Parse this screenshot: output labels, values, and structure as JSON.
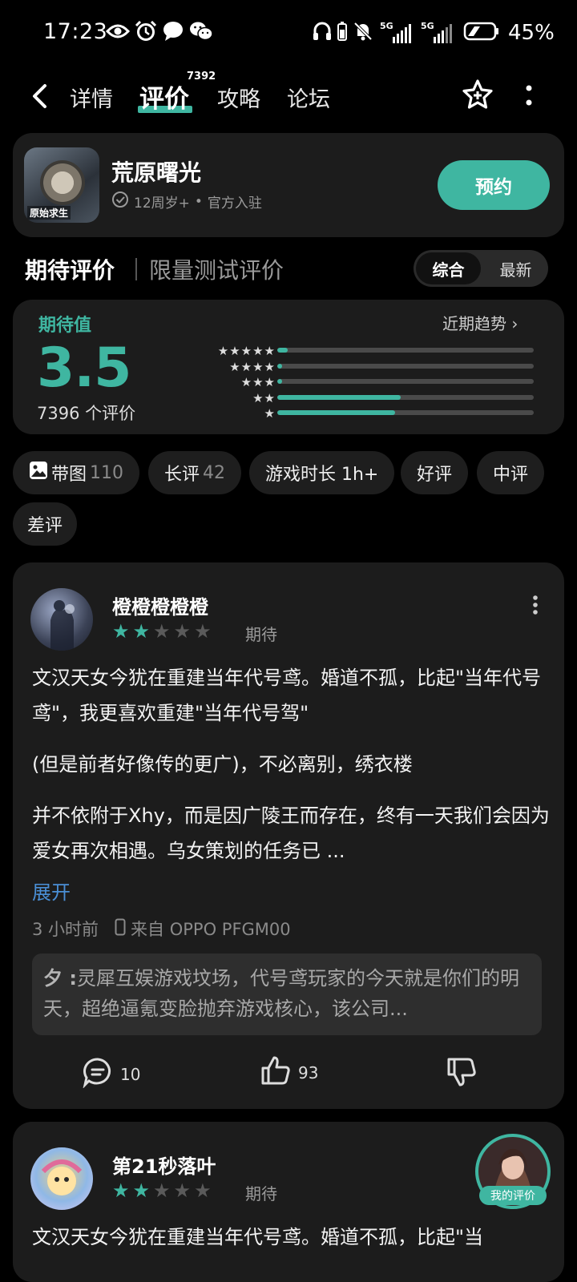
{
  "status_bar": {
    "time": "17:23",
    "battery": "45%",
    "left_icons": [
      "eye-icon",
      "alarm-icon",
      "chat-bubble-icon",
      "wechat-icon"
    ],
    "right_icons": [
      "headphones-icon",
      "battery-small-icon",
      "mute-bell-icon",
      "signal-5g-icon",
      "signal-5g-icon",
      "battery-icon"
    ],
    "net1": "5G",
    "net2": "5G"
  },
  "nav": {
    "tabs": [
      "详情",
      "评价",
      "攻略",
      "论坛"
    ],
    "active_tab": "评价",
    "badge": "7392"
  },
  "game": {
    "title": "荒原曙光",
    "icon_caption": "原始求生",
    "age": "12周岁+",
    "official": "官方入驻",
    "reserve_label": "预约"
  },
  "rating_header": {
    "main": "期待评价",
    "sub": "限量测试评价",
    "sort_options": [
      "综合",
      "最新"
    ],
    "sort_selected": "综合"
  },
  "score": {
    "label": "期待值",
    "value": "3.5",
    "count_text": "7396 个评价",
    "trend_label": "近期趋势",
    "distribution": [
      {
        "stars": "★★★★★",
        "fraction": 0.04
      },
      {
        "stars": "★★★★",
        "fraction": 0.02
      },
      {
        "stars": "★★★",
        "fraction": 0.02
      },
      {
        "stars": "★★",
        "fraction": 0.48
      },
      {
        "stars": "★",
        "fraction": 0.46
      }
    ],
    "accent": "#3fb6a1"
  },
  "filters": [
    {
      "label": "带图",
      "count": "110",
      "icon": "image-icon"
    },
    {
      "label": "长评",
      "count": "42"
    },
    {
      "label": "游戏时长 1h+",
      "count": ""
    },
    {
      "label": "好评",
      "count": ""
    },
    {
      "label": "中评",
      "count": ""
    },
    {
      "label": "差评",
      "count": ""
    }
  ],
  "reviews": [
    {
      "name": "橙橙橙橙橙",
      "rating": 2,
      "tag": "期待",
      "paragraphs": [
        "文汉天女今犹在重建当年代号鸢。婚道不孤，比起\"当年代号鸢\"，我更喜欢重建\"当年代号驾\"",
        "(但是前者好像传的更广)，不必离别，绣衣楼",
        "并不依附于Xhy，而是因广陵王而存在，终有一天我们会因为爱女再次相遇。乌女策划的任务已 ..."
      ],
      "expand_label": "展开",
      "time": "3 小时前",
      "device": "来自 OPPO PFGM00",
      "reply_author": "夕 :",
      "reply_text": "灵犀互娱游戏坟场，代号鸢玩家的今天就是你们的明天，超绝逼氪变脸抛弃游戏核心，该公司...",
      "comments": "10",
      "likes": "93"
    },
    {
      "name": "第21秒落叶",
      "rating": 2,
      "tag": "期待",
      "first_line": "文汉天女今犹在重建当年代号鸢。婚道不孤，比起\"当",
      "my_review_label": "我的评价"
    }
  ]
}
